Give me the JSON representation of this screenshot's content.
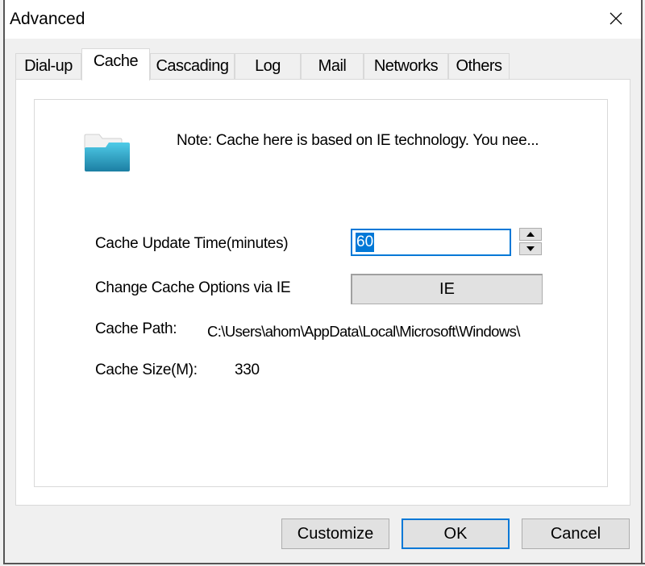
{
  "window": {
    "title": "Advanced",
    "close_icon": "close-icon"
  },
  "tabs": [
    {
      "label": "Dial-up",
      "active": false
    },
    {
      "label": "Cache",
      "active": true
    },
    {
      "label": "Cascading",
      "active": false
    },
    {
      "label": "Log",
      "active": false
    },
    {
      "label": "Mail",
      "active": false
    },
    {
      "label": "Networks",
      "active": false
    },
    {
      "label": "Others",
      "active": false
    }
  ],
  "cache": {
    "icon": "folder-icon",
    "note": "Note: Cache here is based on IE technology. You nee...",
    "update_time_label": "Cache Update Time(minutes)",
    "update_time_value": "60",
    "change_options_label": "Change Cache Options via IE",
    "ie_button_label": "IE",
    "path_label": "Cache Path:",
    "path_value": "C:\\Users\\ahom\\AppData\\Local\\Microsoft\\Windows\\",
    "size_label": "Cache Size(M):",
    "size_value": "330"
  },
  "buttons": {
    "customize": "Customize",
    "ok": "OK",
    "cancel": "Cancel"
  },
  "colors": {
    "accent": "#0078d7",
    "folder": "#2a9fc4"
  }
}
